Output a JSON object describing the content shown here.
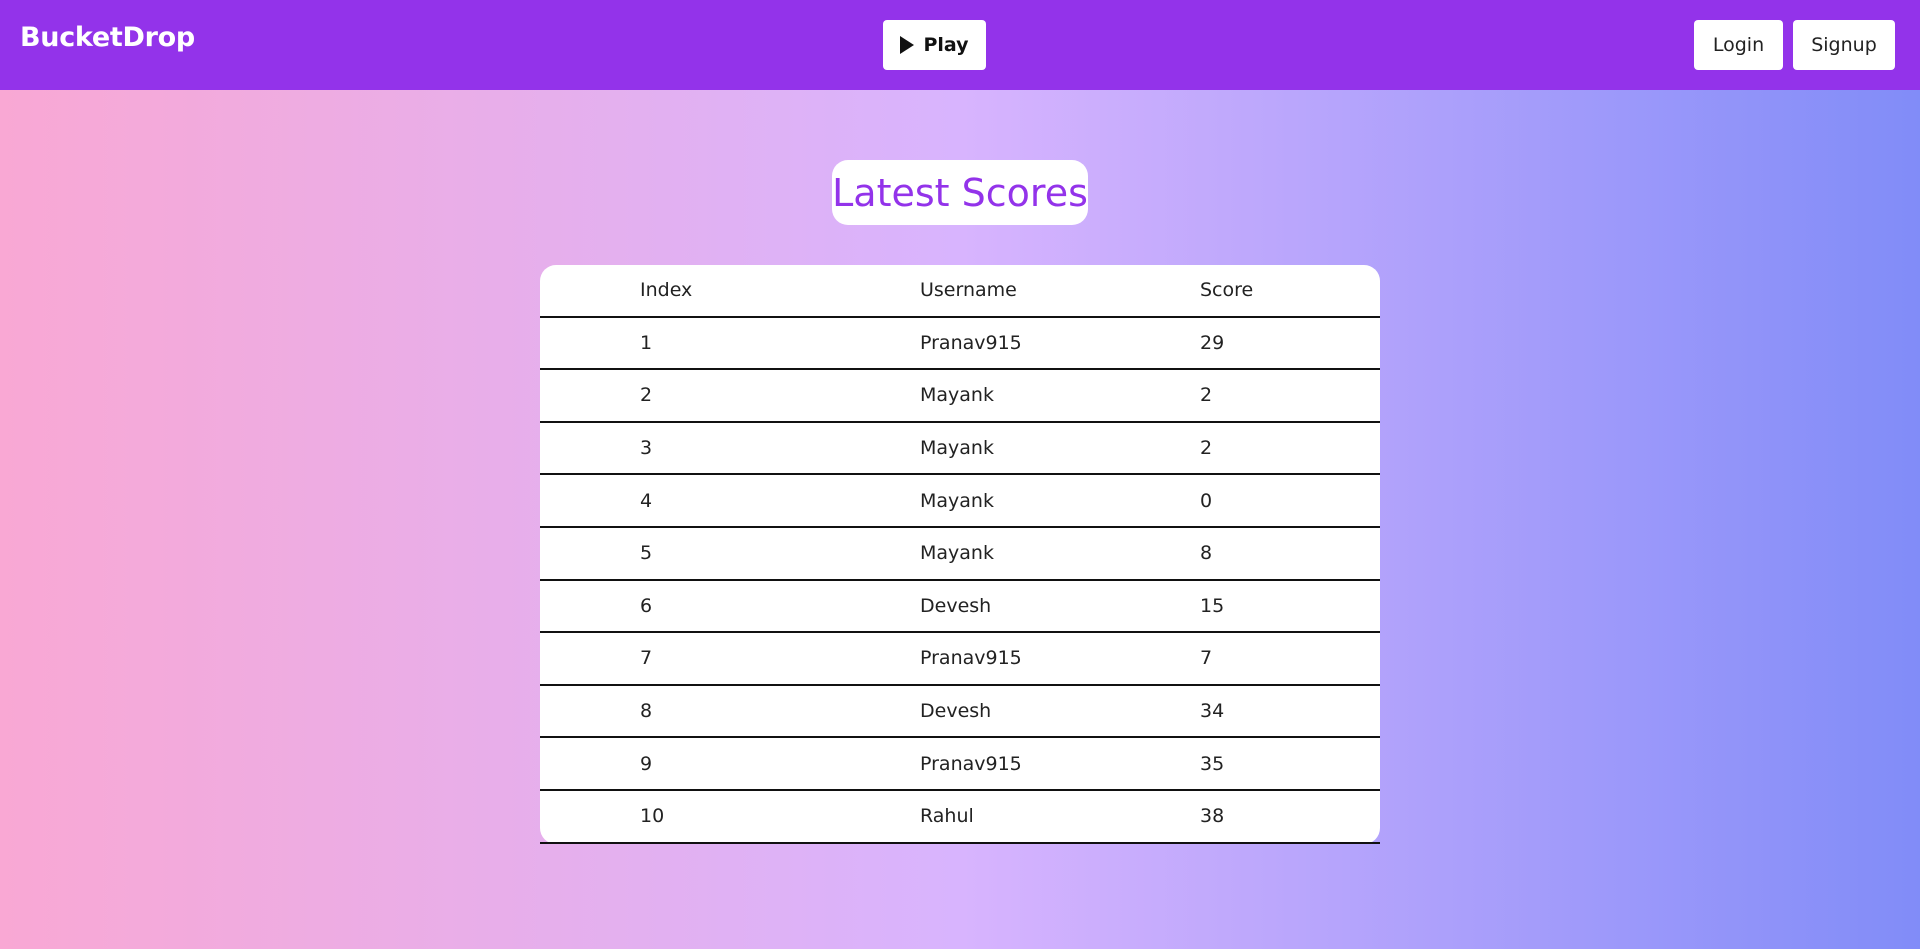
{
  "navbar": {
    "brand": "BucketDrop",
    "play_label": "Play",
    "login_label": "Login",
    "signup_label": "Signup"
  },
  "main": {
    "heading": "Latest Scores",
    "table": {
      "headers": [
        "Index",
        "Username",
        "Score"
      ],
      "rows": [
        [
          "1",
          "Pranav915",
          "29"
        ],
        [
          "2",
          "Mayank",
          "2"
        ],
        [
          "3",
          "Mayank",
          "2"
        ],
        [
          "4",
          "Mayank",
          "0"
        ],
        [
          "5",
          "Mayank",
          "8"
        ],
        [
          "6",
          "Devesh",
          "15"
        ],
        [
          "7",
          "Pranav915",
          "7"
        ],
        [
          "8",
          "Devesh",
          "34"
        ],
        [
          "9",
          "Pranav915",
          "35"
        ],
        [
          "10",
          "Rahul",
          "38"
        ]
      ]
    }
  },
  "colors": {
    "navbar": "#9333ea",
    "accent": "#9333ea",
    "gradient_start": "#f9a8d4",
    "gradient_mid": "#d8b4fe",
    "gradient_end": "#818cf8"
  },
  "icons": {
    "play": "play-icon"
  }
}
